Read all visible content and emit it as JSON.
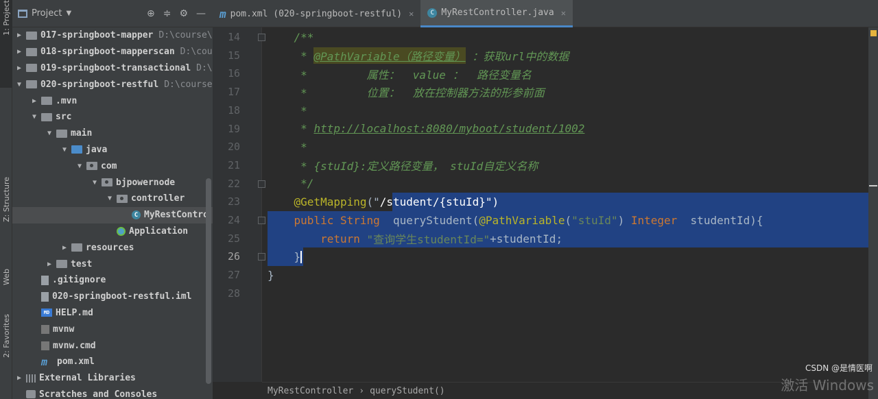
{
  "left_strip": {
    "tabs": [
      {
        "label": "1: Project",
        "icon": "folder-icon"
      },
      {
        "label": "Z: Structure",
        "icon": "structure-icon"
      },
      {
        "label": "Web",
        "icon": "web-icon"
      },
      {
        "label": "2: Favorites",
        "icon": "star-icon"
      }
    ]
  },
  "project_panel": {
    "title": "Project",
    "tree": [
      {
        "label": "017-springboot-mapper",
        "path": "D:\\course\\",
        "depth": 0,
        "arrow": "▶",
        "icon": "module-folder-icon"
      },
      {
        "label": "018-springboot-mapperscan",
        "path": "D:\\cou",
        "depth": 0,
        "arrow": "▶",
        "icon": "module-folder-icon"
      },
      {
        "label": "019-springboot-transactional",
        "path": "D:\\",
        "depth": 0,
        "arrow": "▶",
        "icon": "module-folder-icon"
      },
      {
        "label": "020-springboot-restful",
        "path": "D:\\course",
        "depth": 0,
        "arrow": "▼",
        "icon": "module-folder-icon"
      },
      {
        "label": ".mvn",
        "depth": 1,
        "arrow": "▶",
        "icon": "folder-icon"
      },
      {
        "label": "src",
        "depth": 1,
        "arrow": "▼",
        "icon": "folder-icon"
      },
      {
        "label": "main",
        "depth": 2,
        "arrow": "▼",
        "icon": "folder-icon"
      },
      {
        "label": "java",
        "depth": 3,
        "arrow": "▼",
        "icon": "source-folder-icon"
      },
      {
        "label": "com",
        "depth": 4,
        "arrow": "▼",
        "icon": "package-icon"
      },
      {
        "label": "bjpowernode",
        "depth": 5,
        "arrow": "▼",
        "icon": "package-icon"
      },
      {
        "label": "controller",
        "depth": 6,
        "arrow": "▼",
        "icon": "package-icon"
      },
      {
        "label": "MyRestContro",
        "depth": 7,
        "arrow": "",
        "icon": "class-icon",
        "selected": true
      },
      {
        "label": "Application",
        "depth": 6,
        "arrow": "",
        "icon": "spring-boot-icon"
      },
      {
        "label": "resources",
        "depth": 3,
        "arrow": "▶",
        "icon": "resources-folder-icon"
      },
      {
        "label": "test",
        "depth": 2,
        "arrow": "▶",
        "icon": "folder-icon"
      },
      {
        "label": ".gitignore",
        "depth": 1,
        "arrow": "",
        "icon": "gitignore-icon"
      },
      {
        "label": "020-springboot-restful.iml",
        "depth": 1,
        "arrow": "",
        "icon": "iml-file-icon"
      },
      {
        "label": "HELP.md",
        "depth": 1,
        "arrow": "",
        "icon": "markdown-icon"
      },
      {
        "label": "mvnw",
        "depth": 1,
        "arrow": "",
        "icon": "script-file-icon"
      },
      {
        "label": "mvnw.cmd",
        "depth": 1,
        "arrow": "",
        "icon": "script-file-icon"
      },
      {
        "label": "pom.xml",
        "depth": 1,
        "arrow": "",
        "icon": "maven-icon"
      },
      {
        "label": "External Libraries",
        "depth": 0,
        "arrow": "▶",
        "icon": "libraries-icon"
      },
      {
        "label": "Scratches and Consoles",
        "depth": 0,
        "arrow": "",
        "icon": "scratches-icon"
      }
    ]
  },
  "editor": {
    "tabs": [
      {
        "label": "pom.xml (020-springboot-restful)",
        "icon": "maven-icon",
        "active": false
      },
      {
        "label": "MyRestController.java",
        "icon": "class-icon",
        "active": true
      }
    ],
    "line_numbers": [
      "14",
      "15",
      "16",
      "17",
      "18",
      "19",
      "20",
      "21",
      "22",
      "23",
      "24",
      "25",
      "26",
      "27",
      "28"
    ],
    "current_line": "26",
    "lines": [
      {
        "n": "14",
        "indent": "    ",
        "parts": [
          {
            "t": "/**",
            "c": "comment"
          }
        ]
      },
      {
        "n": "15",
        "indent": "     ",
        "parts": [
          {
            "t": "* ",
            "c": "comment"
          },
          {
            "t": "@PathVariable（路径变量）",
            "c": "tag"
          },
          {
            "t": " ：获取url中的数据",
            "c": "comment"
          }
        ]
      },
      {
        "n": "16",
        "indent": "     ",
        "parts": [
          {
            "t": "*         属性：  value ：  路径变量名",
            "c": "comment"
          }
        ]
      },
      {
        "n": "17",
        "indent": "     ",
        "parts": [
          {
            "t": "*         位置：  放在控制器方法的形参前面",
            "c": "comment"
          }
        ]
      },
      {
        "n": "18",
        "indent": "     ",
        "parts": [
          {
            "t": "*",
            "c": "comment"
          }
        ]
      },
      {
        "n": "19",
        "indent": "     ",
        "parts": [
          {
            "t": "* ",
            "c": "comment"
          },
          {
            "t": "http://localhost:8080/myboot/student/1002",
            "c": "url"
          }
        ]
      },
      {
        "n": "20",
        "indent": "     ",
        "parts": [
          {
            "t": "*",
            "c": "comment"
          }
        ]
      },
      {
        "n": "21",
        "indent": "     ",
        "parts": [
          {
            "t": "* {stuId}:定义路径变量， stuId自定义名称",
            "c": "comment"
          }
        ]
      },
      {
        "n": "22",
        "indent": "     ",
        "parts": [
          {
            "t": "*/",
            "c": "comment"
          }
        ]
      },
      {
        "n": "23",
        "indent": "    ",
        "parts": [
          {
            "t": "@GetMapping",
            "c": "anno"
          },
          {
            "t": "(\"",
            "c": "plain"
          },
          {
            "t": "/student/{stuId}\")",
            "c": "sel"
          }
        ]
      },
      {
        "n": "24",
        "indent": "    ",
        "parts": [
          {
            "t": "public String",
            "c": "kw"
          },
          {
            "t": "  queryStudent(",
            "c": "plain"
          },
          {
            "t": "@PathVariable",
            "c": "anno"
          },
          {
            "t": "(",
            "c": "plain"
          },
          {
            "t": "\"stuId\"",
            "c": "str"
          },
          {
            "t": ") ",
            "c": "plain"
          },
          {
            "t": "Integer",
            "c": "kw"
          },
          {
            "t": "  studentId){",
            "c": "plain"
          }
        ]
      },
      {
        "n": "25",
        "indent": "        ",
        "parts": [
          {
            "t": "return ",
            "c": "kw"
          },
          {
            "t": "\"查询学生studentId=\"",
            "c": "str"
          },
          {
            "t": "+studentId;",
            "c": "plain"
          }
        ]
      },
      {
        "n": "26",
        "indent": "    ",
        "parts": [
          {
            "t": "}",
            "c": "plain"
          }
        ],
        "caret": true
      },
      {
        "n": "27",
        "indent": "",
        "parts": [
          {
            "t": "}",
            "c": "plain"
          }
        ]
      },
      {
        "n": "28",
        "indent": "",
        "parts": []
      }
    ],
    "breadcrumb": [
      "MyRestController",
      "queryStudent()"
    ]
  },
  "overlay": {
    "csdn": "CSDN @是情医啊",
    "activation": "激活 Windows"
  },
  "colors": {
    "selection": "#214283",
    "comment": "#629755",
    "keyword": "#cc7832",
    "annotation": "#bbb529",
    "string": "#6a8759"
  }
}
